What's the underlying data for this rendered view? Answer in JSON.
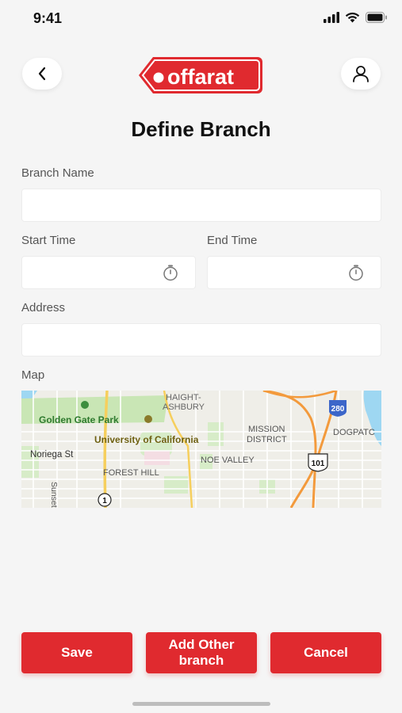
{
  "status_bar": {
    "time": "9:41"
  },
  "header": {
    "logo_text": "offarat"
  },
  "page": {
    "title": "Define Branch"
  },
  "form": {
    "branch_name_label": "Branch Name",
    "branch_name_value": "",
    "start_time_label": "Start Time",
    "start_time_value": "",
    "end_time_label": "End Time",
    "end_time_value": "",
    "address_label": "Address",
    "address_value": "",
    "map_label": "Map"
  },
  "map": {
    "labels": {
      "haight_ashbury": "HAIGHT-\nASHBURY",
      "golden_gate_park": "Golden Gate Park",
      "university": "University of California",
      "mission_district": "MISSION\nDISTRICT",
      "dogpatch": "DOGPATC",
      "noriega": "Noriega St",
      "noe_valley": "NOE VALLEY",
      "forest_hill": "FOREST HILL",
      "sunset_blvd": "Sunset Blvd",
      "hwy_101": "101",
      "hwy_280": "280",
      "hwy_1": "1"
    }
  },
  "actions": {
    "save": "Save",
    "add_other": "Add Other\nbranch",
    "cancel": "Cancel"
  },
  "colors": {
    "brand_red": "#e02a2f"
  }
}
